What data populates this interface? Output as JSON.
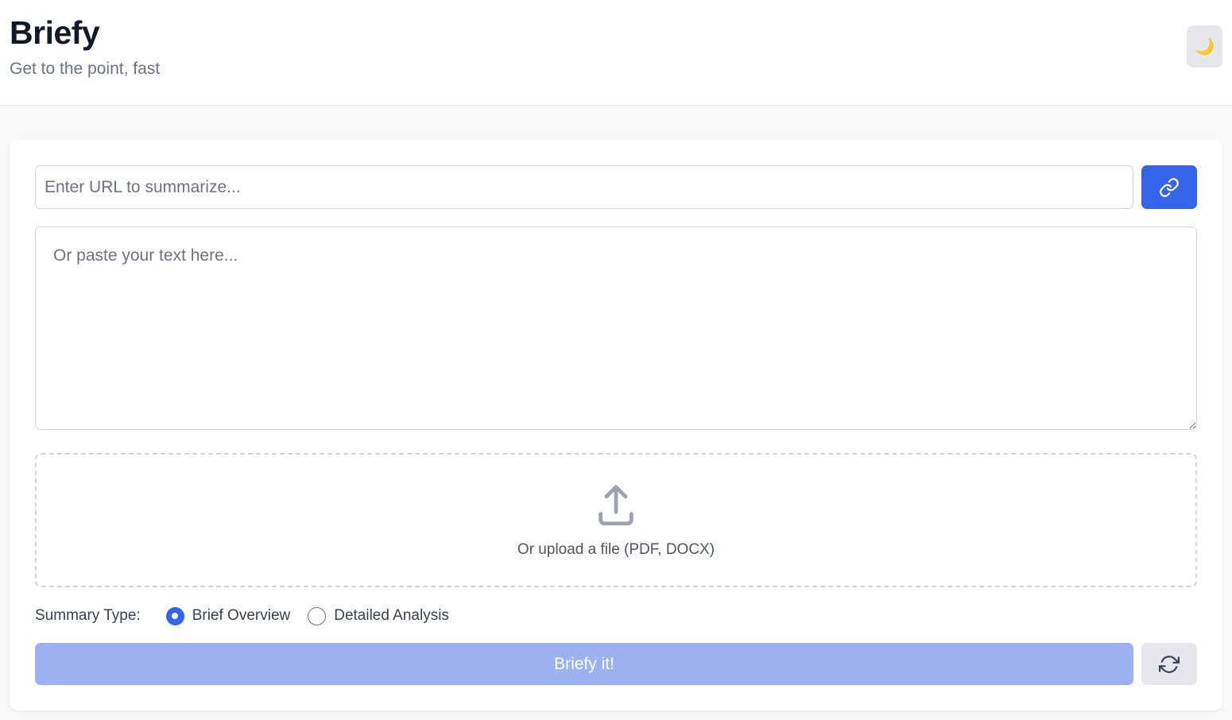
{
  "header": {
    "title": "Briefy",
    "subtitle": "Get to the point, fast",
    "theme_toggle_icon": "moon-icon",
    "theme_toggle_glyph": "🌙"
  },
  "form": {
    "url_placeholder": "Enter URL to summarize...",
    "url_value": "",
    "url_button_icon": "link-icon",
    "text_placeholder": "Or paste your text here...",
    "text_value": "",
    "upload_icon": "upload-icon",
    "upload_label": "Or upload a file (PDF, DOCX)",
    "summary_type_label": "Summary Type:",
    "summary_options": [
      {
        "label": "Brief Overview",
        "selected": true
      },
      {
        "label": "Detailed Analysis",
        "selected": false
      }
    ],
    "submit_label": "Briefy it!",
    "submit_enabled": false,
    "reset_icon": "refresh-icon"
  },
  "colors": {
    "accent": "#3563e9",
    "accent_disabled": "#9cb1f0",
    "secondary_button": "#e5e7eb",
    "page_background": "#f7f8fa"
  }
}
